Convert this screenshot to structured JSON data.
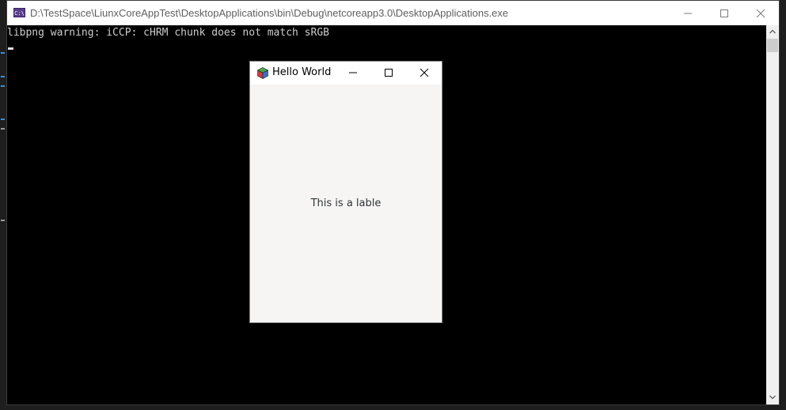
{
  "console": {
    "title": "D:\\TestSpace\\LiunxCoreAppTest\\DesktopApplications\\bin\\Debug\\netcoreapp3.0\\DesktopApplications.exe",
    "icon_text": "C:\\",
    "icon": "console-app-icon",
    "output_lines": [
      "libpng warning: iCCP: cHRM chunk does not match sRGB"
    ],
    "scroll_position": 0.0
  },
  "hello_window": {
    "title": "Hello World",
    "icon": "gtk-cube-icon",
    "label_text": "This is a lable"
  },
  "colors": {
    "console_background": "#000000",
    "console_text": "#cccccc",
    "titlebar_background": "#ffffff",
    "gtk_window_background": "#f6f5f4"
  }
}
